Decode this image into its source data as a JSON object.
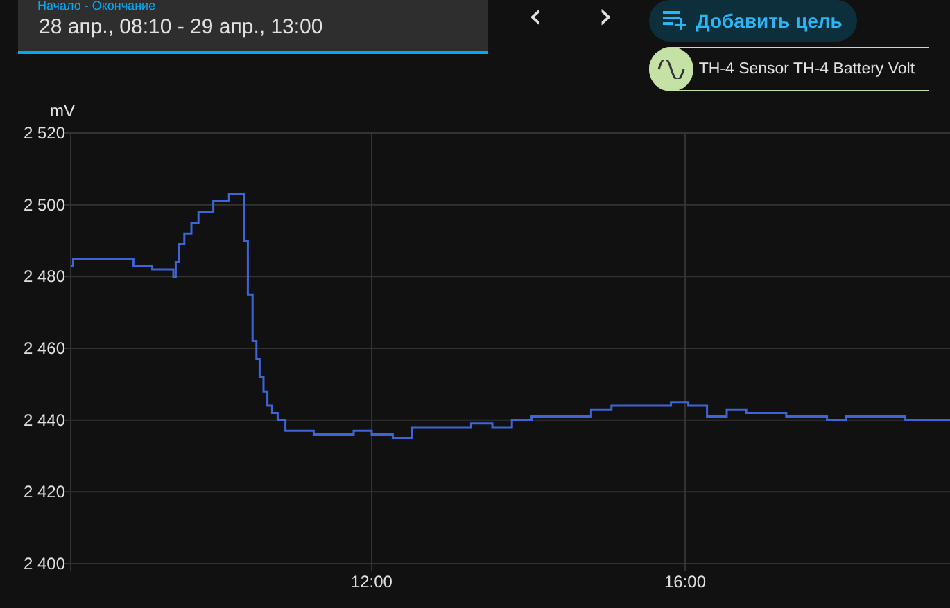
{
  "date_range": {
    "label": "Начало - Окончание",
    "value": "28 апр., 08:10 - 29 апр., 13:00"
  },
  "nav": {
    "prev": "‹",
    "next": "›"
  },
  "add_target_button": {
    "label": "Добавить цель"
  },
  "entity_chip": {
    "label": "TH-4 Sensor TH-4 Battery Volt"
  },
  "chart": {
    "chart_data": {
      "type": "line",
      "ylabel": "mV",
      "grid": true,
      "xlim": [
        8.16,
        19.38
      ],
      "ylim": [
        2400,
        2520
      ],
      "xticks": [
        {
          "value": 12,
          "label": "12:00"
        },
        {
          "value": 16,
          "label": "16:00"
        }
      ],
      "yticks": [
        {
          "value": 2400,
          "label": "2 400"
        },
        {
          "value": 2420,
          "label": "2 420"
        },
        {
          "value": 2440,
          "label": "2 440"
        },
        {
          "value": 2460,
          "label": "2 460"
        },
        {
          "value": 2480,
          "label": "2 480"
        },
        {
          "value": 2500,
          "label": "2 500"
        },
        {
          "value": 2520,
          "label": "2 520"
        }
      ],
      "x": [
        8.16,
        8.19,
        8.19,
        8.96,
        8.96,
        9.2,
        9.2,
        9.47,
        9.47,
        9.5,
        9.5,
        9.54,
        9.54,
        9.61,
        9.61,
        9.7,
        9.7,
        9.79,
        9.79,
        9.98,
        9.98,
        10.18,
        10.18,
        10.37,
        10.37,
        10.42,
        10.42,
        10.48,
        10.48,
        10.53,
        10.53,
        10.57,
        10.57,
        10.62,
        10.62,
        10.67,
        10.67,
        10.73,
        10.73,
        10.8,
        10.8,
        10.9,
        10.9,
        11.26,
        11.26,
        11.77,
        11.77,
        12.0,
        12.0,
        12.27,
        12.27,
        12.51,
        12.51,
        13.27,
        13.27,
        13.54,
        13.54,
        13.79,
        13.79,
        14.04,
        14.04,
        14.8,
        14.8,
        15.06,
        15.06,
        15.82,
        15.82,
        16.04,
        16.04,
        16.28,
        16.28,
        16.53,
        16.53,
        16.78,
        16.78,
        17.29,
        17.29,
        17.81,
        17.81,
        18.05,
        18.05,
        18.81,
        18.81,
        19.38
      ],
      "series": [
        {
          "color": "#3d65d8",
          "values": [
            2483,
            2483,
            2485,
            2485,
            2483,
            2483,
            2482,
            2482,
            2480,
            2480,
            2484,
            2484,
            2489,
            2489,
            2492,
            2492,
            2495,
            2495,
            2498,
            2498,
            2501,
            2501,
            2503,
            2503,
            2490,
            2490,
            2475,
            2475,
            2462,
            2462,
            2457,
            2457,
            2452,
            2452,
            2448,
            2448,
            2444,
            2444,
            2442,
            2442,
            2440,
            2440,
            2437,
            2437,
            2436,
            2436,
            2437,
            2437,
            2436,
            2436,
            2435,
            2435,
            2438,
            2438,
            2439,
            2439,
            2438,
            2438,
            2440,
            2440,
            2441,
            2441,
            2443,
            2443,
            2444,
            2444,
            2445,
            2445,
            2444,
            2444,
            2441,
            2441,
            2443,
            2443,
            2442,
            2442,
            2441,
            2441,
            2440,
            2440,
            2441,
            2441,
            2440,
            2440
          ]
        }
      ]
    }
  }
}
